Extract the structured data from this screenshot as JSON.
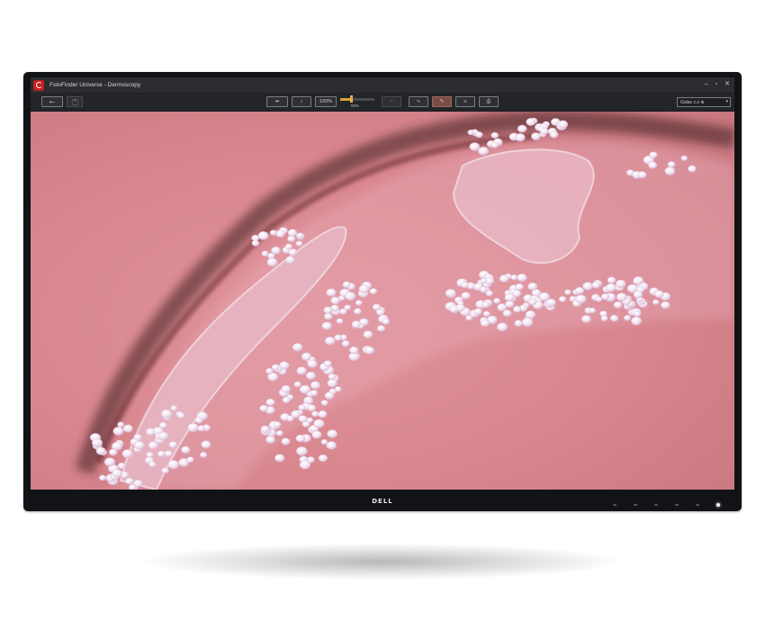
{
  "window": {
    "title": "FotoFinder Universe - Dermoscopy",
    "controls": {
      "minimize": "–",
      "restore": "▫",
      "close": "✕"
    }
  },
  "toolbar": {
    "back_icon": "arrow-left-icon",
    "save_icon": "floppy-disk-icon",
    "btn_fit": "⇹",
    "btn_fit_height": "↕",
    "zoom_value": "100%",
    "zoom_fraction": 0.32,
    "slider_label": "50%",
    "btn_measure": "⌗",
    "btn_graph": "∿",
    "btn_draw": "✎",
    "btn_stack": "≡",
    "btn_export": "⎙",
    "camera_select": "Galax z.o ⊕",
    "select_caret": "▾"
  },
  "monitor": {
    "brand": "DELL"
  },
  "image": {
    "description_icon": "dermoscopy-image"
  },
  "colors": {
    "accent": "#d7a23a",
    "brand_red": "#c41f1f",
    "bezel": "#121316",
    "skin": "#d9868e"
  }
}
